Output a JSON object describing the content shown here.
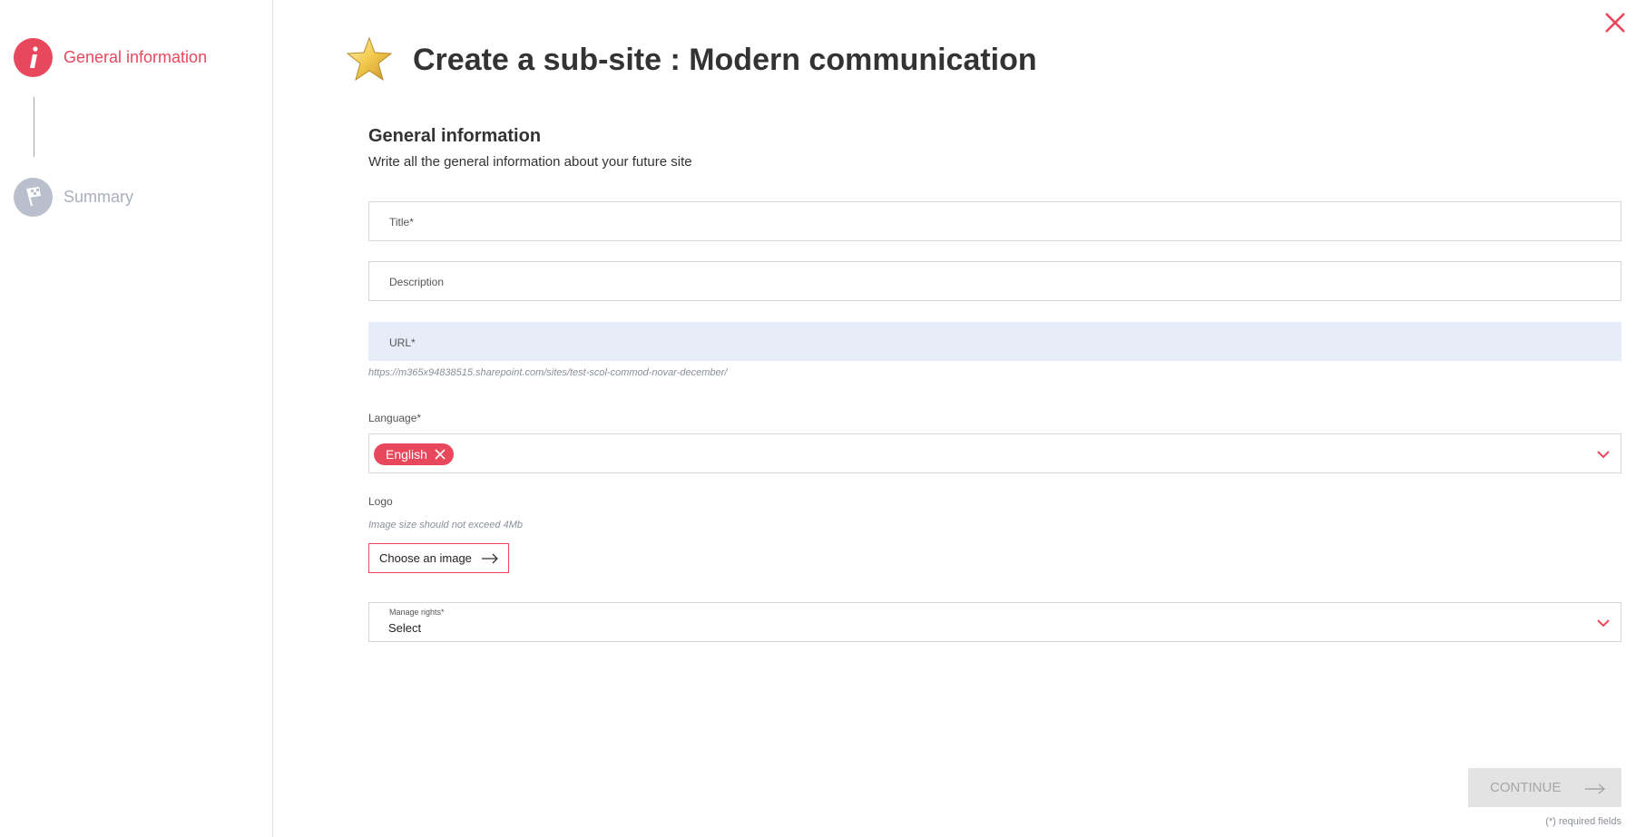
{
  "sidebar": {
    "steps": [
      {
        "label": "General information",
        "icon": "info-icon",
        "state": "active",
        "color": "#e8485c"
      },
      {
        "label": "Summary",
        "icon": "flag-icon",
        "state": "inactive",
        "color": "#b9bfcc"
      }
    ]
  },
  "header": {
    "title": "Create a sub-site : Modern communication",
    "icon": "star-icon"
  },
  "form": {
    "section_title": "General information",
    "section_subtitle": "Write all the general information about your future site",
    "title_placeholder": "Title*",
    "description_placeholder": "Description",
    "url_placeholder": "URL*",
    "url_hint": "https://m365x94838515.sharepoint.com/sites/test-scol-commod-novar-december/",
    "language_label": "Language*",
    "language_chip": "English",
    "logo_label": "Logo",
    "logo_hint": "Image size should not exceed 4Mb",
    "choose_image_label": "Choose an image",
    "rights_label": "Manage rights*",
    "rights_value": "Select"
  },
  "footer": {
    "continue_label": "CONTINUE",
    "required_note": "(*) required fields"
  },
  "colors": {
    "accent": "#e8485c",
    "inactive": "#b9bfcc",
    "url_bg": "#e6edf8",
    "disabled_bg": "#e3e3e3"
  }
}
